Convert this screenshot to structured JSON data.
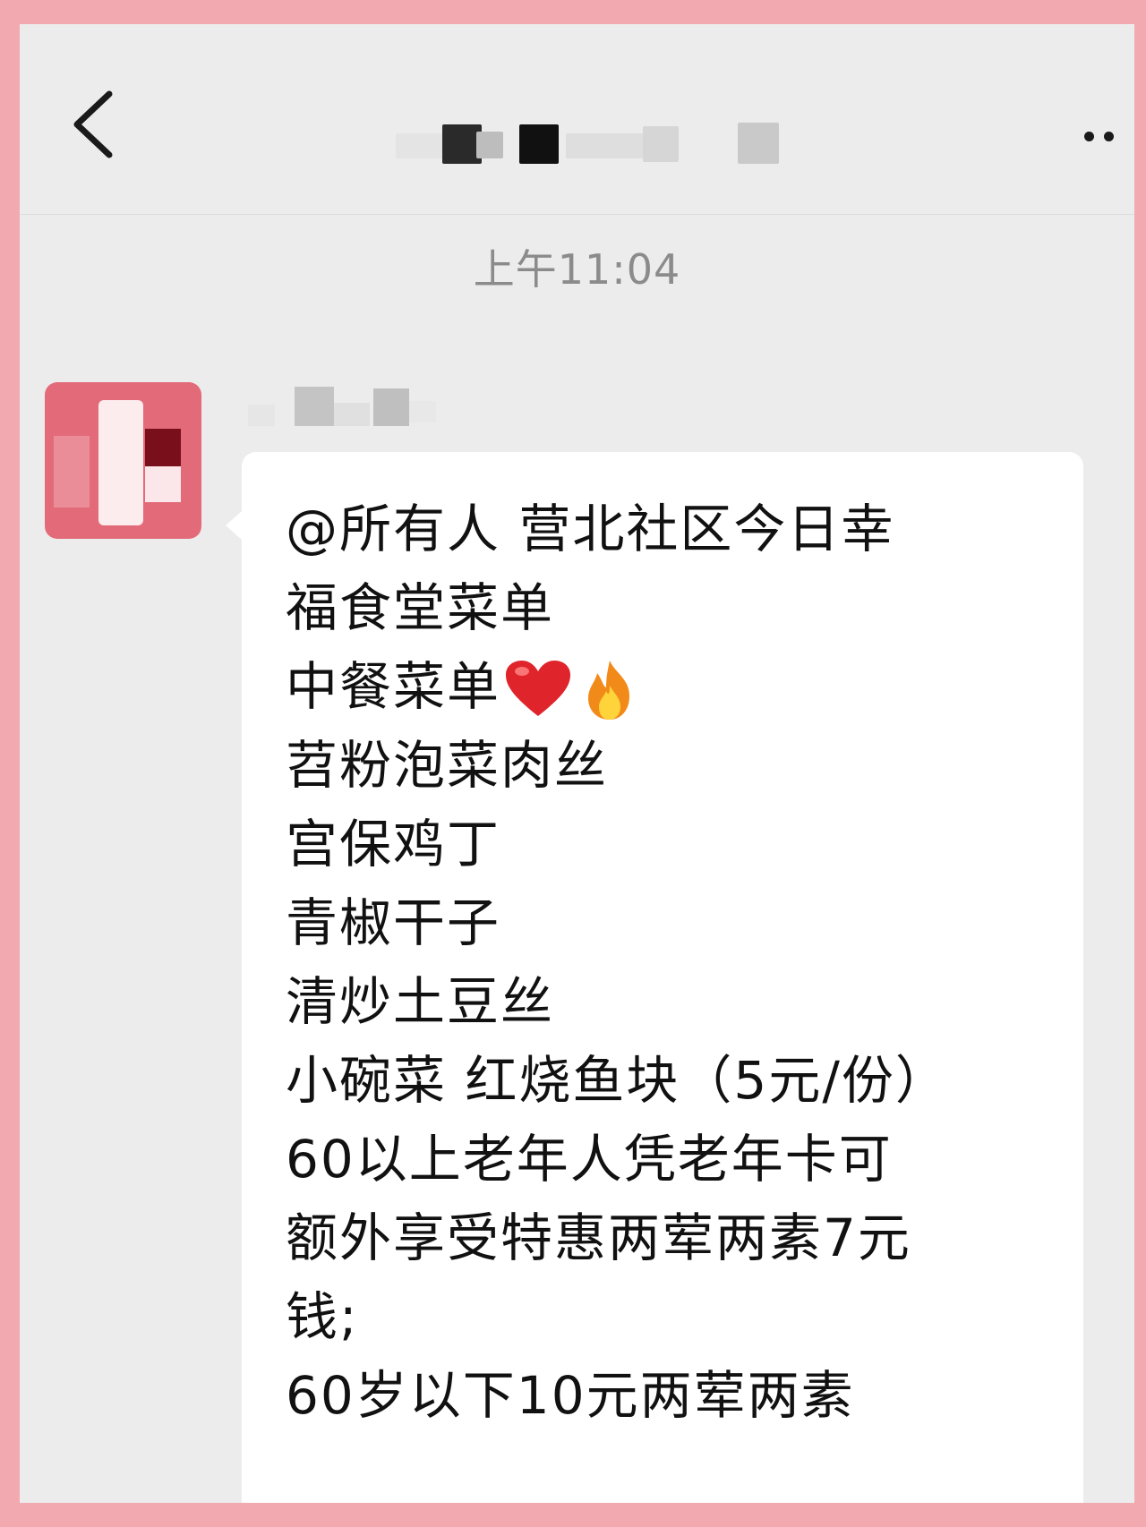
{
  "timestamp": "上午11:04",
  "message": {
    "lines": [
      "@所有人  营北社区今日幸",
      "福食堂菜单",
      "中餐菜单",
      "苕粉泡菜肉丝",
      "宫保鸡丁",
      "青椒干子",
      "清炒土豆丝",
      "小碗菜  红烧鱼块（5元/份）",
      "60以上老年人凭老年卡可",
      "额外享受特惠两荤两素7元",
      "钱;",
      "60岁以下10元两荤两素"
    ],
    "emojis": [
      "heart-emoji",
      "fire-emoji"
    ]
  },
  "colors": {
    "frame": "#f2aab0",
    "background": "#ececec",
    "bubble": "#ffffff",
    "timestamp_text": "#8b8b8b",
    "avatar": "#e36b79"
  },
  "icons": {
    "back": "chevron-left-icon",
    "more": "more-dots-icon"
  }
}
